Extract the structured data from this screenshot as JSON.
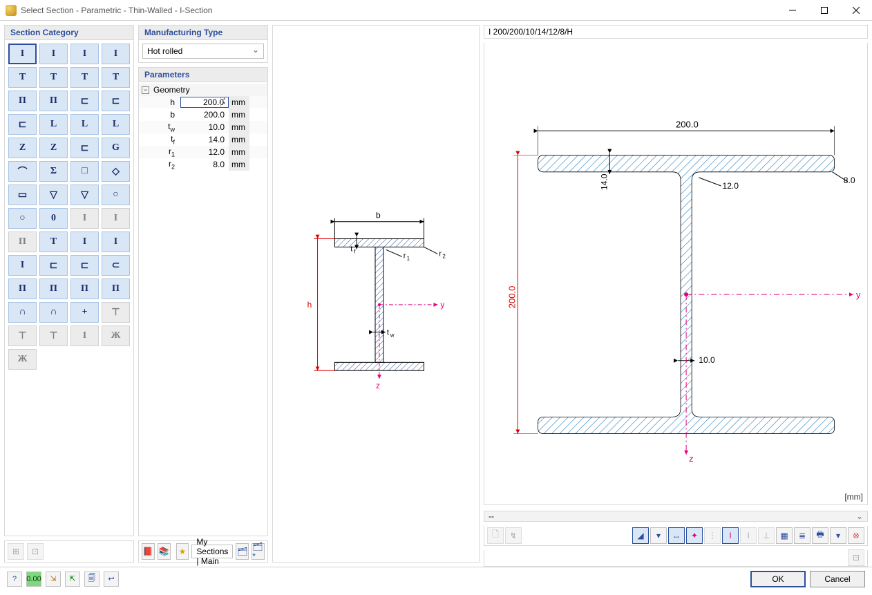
{
  "window": {
    "title": "Select Section - Parametric - Thin-Walled - I-Section"
  },
  "left": {
    "header": "Section Category",
    "items": [
      {
        "g": "I",
        "sel": true
      },
      {
        "g": "I"
      },
      {
        "g": "I"
      },
      {
        "g": "I"
      },
      {
        "g": "T"
      },
      {
        "g": "T"
      },
      {
        "g": "T"
      },
      {
        "g": "T"
      },
      {
        "g": "Π"
      },
      {
        "g": "Π"
      },
      {
        "g": "⊏"
      },
      {
        "g": "⊏"
      },
      {
        "g": "⊏"
      },
      {
        "g": "L"
      },
      {
        "g": "L"
      },
      {
        "g": "L"
      },
      {
        "g": "Z"
      },
      {
        "g": "Z"
      },
      {
        "g": "⊏"
      },
      {
        "g": "G"
      },
      {
        "g": "⌒"
      },
      {
        "g": "Σ"
      },
      {
        "g": "□"
      },
      {
        "g": "◇"
      },
      {
        "g": "▭"
      },
      {
        "g": "▽"
      },
      {
        "g": "▽"
      },
      {
        "g": "○"
      },
      {
        "g": "○"
      },
      {
        "g": "0"
      },
      {
        "g": "I",
        "dim": true
      },
      {
        "g": "I",
        "dim": true
      },
      {
        "g": "Π",
        "dim": true
      },
      {
        "g": "T"
      },
      {
        "g": "I"
      },
      {
        "g": "I"
      },
      {
        "g": "I"
      },
      {
        "g": "⊏"
      },
      {
        "g": "⊏"
      },
      {
        "g": "⊂"
      },
      {
        "g": "Π"
      },
      {
        "g": "Π"
      },
      {
        "g": "Π"
      },
      {
        "g": "Π"
      },
      {
        "g": "∩"
      },
      {
        "g": "∩"
      },
      {
        "g": "+"
      },
      {
        "g": "⊤",
        "dim": true
      },
      {
        "g": "⊤",
        "dim": true
      },
      {
        "g": "⊤",
        "dim": true
      },
      {
        "g": "I",
        "dim": true
      },
      {
        "g": "Ж",
        "dim": true
      },
      {
        "g": "Ж",
        "dim": true
      }
    ]
  },
  "mid": {
    "mfg_header": "Manufacturing Type",
    "mfg_value": "Hot rolled",
    "param_header": "Parameters",
    "group": "Geometry",
    "rows": [
      {
        "name": "h",
        "val": "200.0",
        "unit": "mm",
        "input": true
      },
      {
        "name": "b",
        "val": "200.0",
        "unit": "mm"
      },
      {
        "name": "tw",
        "html": "t<sub>w</sub>",
        "val": "10.0",
        "unit": "mm"
      },
      {
        "name": "tf",
        "html": "t<sub>f</sub>",
        "val": "14.0",
        "unit": "mm"
      },
      {
        "name": "r1",
        "html": "r<sub>1</sub>",
        "val": "12.0",
        "unit": "mm"
      },
      {
        "name": "r2",
        "html": "r<sub>2</sub>",
        "val": "8.0",
        "unit": "mm"
      }
    ],
    "fav_label": "My Sections | Main"
  },
  "preview": {
    "labels": {
      "b": "b",
      "h": "h",
      "tw": "tw",
      "tf": "tf",
      "r1": "r1",
      "r2": "r2",
      "y": "y",
      "z": "z"
    }
  },
  "right": {
    "title": "I 200/200/10/14/12/8/H",
    "dims": {
      "width": "200.0",
      "height": "200.0",
      "tf": "14.0",
      "r1": "12.0",
      "r2": "8.0",
      "tw": "10.0"
    },
    "axes": {
      "y": "y",
      "z": "z"
    },
    "unit": "[mm]",
    "info_value": "--"
  },
  "buttons": {
    "ok": "OK",
    "cancel": "Cancel"
  }
}
